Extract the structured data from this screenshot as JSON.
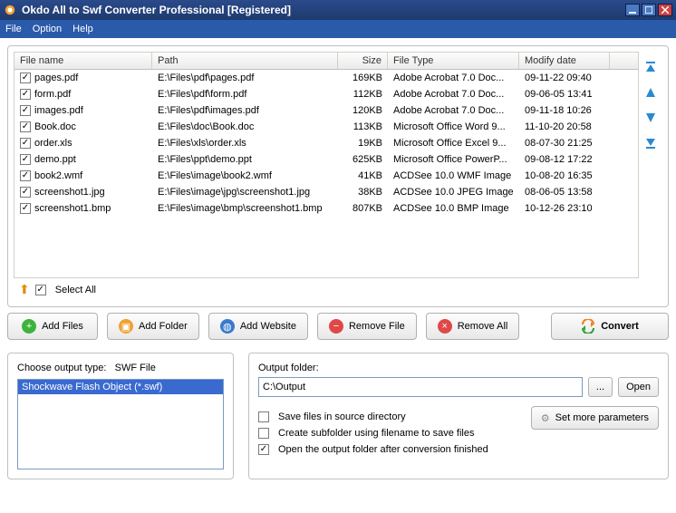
{
  "window": {
    "title": "Okdo All to Swf Converter Professional [Registered]"
  },
  "menu": {
    "file": "File",
    "option": "Option",
    "help": "Help"
  },
  "table": {
    "headers": {
      "name": "File name",
      "path": "Path",
      "size": "Size",
      "type": "File Type",
      "date": "Modify date"
    },
    "rows": [
      {
        "name": "pages.pdf",
        "path": "E:\\Files\\pdf\\pages.pdf",
        "size": "169KB",
        "type": "Adobe Acrobat 7.0 Doc...",
        "date": "09-11-22 09:40"
      },
      {
        "name": "form.pdf",
        "path": "E:\\Files\\pdf\\form.pdf",
        "size": "112KB",
        "type": "Adobe Acrobat 7.0 Doc...",
        "date": "09-06-05 13:41"
      },
      {
        "name": "images.pdf",
        "path": "E:\\Files\\pdf\\images.pdf",
        "size": "120KB",
        "type": "Adobe Acrobat 7.0 Doc...",
        "date": "09-11-18 10:26"
      },
      {
        "name": "Book.doc",
        "path": "E:\\Files\\doc\\Book.doc",
        "size": "113KB",
        "type": "Microsoft Office Word 9...",
        "date": "11-10-20 20:58"
      },
      {
        "name": "order.xls",
        "path": "E:\\Files\\xls\\order.xls",
        "size": "19KB",
        "type": "Microsoft Office Excel 9...",
        "date": "08-07-30 21:25"
      },
      {
        "name": "demo.ppt",
        "path": "E:\\Files\\ppt\\demo.ppt",
        "size": "625KB",
        "type": "Microsoft Office PowerP...",
        "date": "09-08-12 17:22"
      },
      {
        "name": "book2.wmf",
        "path": "E:\\Files\\image\\book2.wmf",
        "size": "41KB",
        "type": "ACDSee 10.0 WMF Image",
        "date": "10-08-20 16:35"
      },
      {
        "name": "screenshot1.jpg",
        "path": "E:\\Files\\image\\jpg\\screenshot1.jpg",
        "size": "38KB",
        "type": "ACDSee 10.0 JPEG Image",
        "date": "08-06-05 13:58"
      },
      {
        "name": "screenshot1.bmp",
        "path": "E:\\Files\\image\\bmp\\screenshot1.bmp",
        "size": "807KB",
        "type": "ACDSee 10.0 BMP Image",
        "date": "10-12-26 23:10"
      }
    ]
  },
  "selectAll": "Select All",
  "buttons": {
    "addFiles": "Add Files",
    "addFolder": "Add Folder",
    "addWebsite": "Add Website",
    "removeFile": "Remove File",
    "removeAll": "Remove All",
    "convert": "Convert"
  },
  "outputType": {
    "label": "Choose output type:",
    "value": "SWF File",
    "item": "Shockwave Flash Object (*.swf)"
  },
  "outputFolder": {
    "label": "Output folder:",
    "path": "C:\\Output",
    "browse": "...",
    "open": "Open",
    "saveSource": "Save files in source directory",
    "createSub": "Create subfolder using filename to save files",
    "openAfter": "Open the output folder after conversion finished",
    "params": "Set more parameters"
  }
}
